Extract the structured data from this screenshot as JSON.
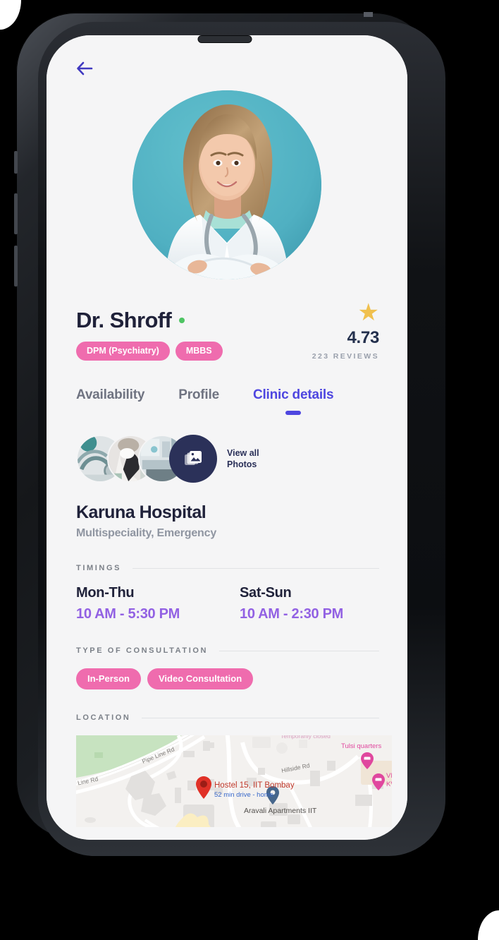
{
  "screen": {
    "back_icon": "arrow-left-icon"
  },
  "doctor": {
    "name": "Dr. Shroff",
    "online_indicator": "online-dot",
    "qualifications": [
      "DPM (Psychiatry)",
      "MBBS"
    ],
    "rating": {
      "star_glyph": "★",
      "value": "4.73",
      "reviews": "223 REVIEWS"
    },
    "avatar_bg": "#53b3c4"
  },
  "tabs": [
    {
      "label": "Availability",
      "active": false
    },
    {
      "label": "Profile",
      "active": false
    },
    {
      "label": "Clinic details",
      "active": true
    }
  ],
  "photos": {
    "view_all_line1": "View all",
    "view_all_line2": "Photos",
    "icon": "photo-stack-icon",
    "thumb_count": 3
  },
  "clinic": {
    "name": "Karuna Hospital",
    "specialities": "Multispeciality, Emergency"
  },
  "timings": {
    "section_label": "TIMINGS",
    "entries": [
      {
        "days": "Mon-Thu",
        "hours": "10 AM - 5:30 PM"
      },
      {
        "days": "Sat-Sun",
        "hours": "10 AM - 2:30 PM"
      }
    ]
  },
  "consultation": {
    "section_label": "TYPE OF CONSULTATION",
    "types": [
      "In-Person",
      "Video Consultation"
    ]
  },
  "location": {
    "section_label": "LOCATION",
    "map_labels": {
      "primary_marker": "Hostel 15, IIT Bombay",
      "primary_marker_sub": "52 min drive - home",
      "poi_tulsi": "Tulsi quarters",
      "poi_tulsi_status": "Temporarily closed",
      "poi_aravali": "Aravali Apartments IIT",
      "poi_vie_1": "VIE",
      "poi_vie_2": "KV",
      "road_pipe_line_1": "Pipe Line Rd",
      "road_pipe_line_2": "e Line Rd",
      "road_hillside": "Hillside Rd"
    },
    "colors": {
      "marker_red": "#e03127",
      "marker_blue": "#46668b",
      "marker_pink": "#e0479e",
      "park_green": "#c7e3c0",
      "drive_text": "#3868c9"
    }
  },
  "theme": {
    "accent_purple": "#4e46e0",
    "chip_pink": "#ef6cae",
    "time_purple": "#9261e3",
    "navy": "#2b3159",
    "star_gold": "#f0c04e",
    "screen_bg": "#f5f5f6"
  }
}
